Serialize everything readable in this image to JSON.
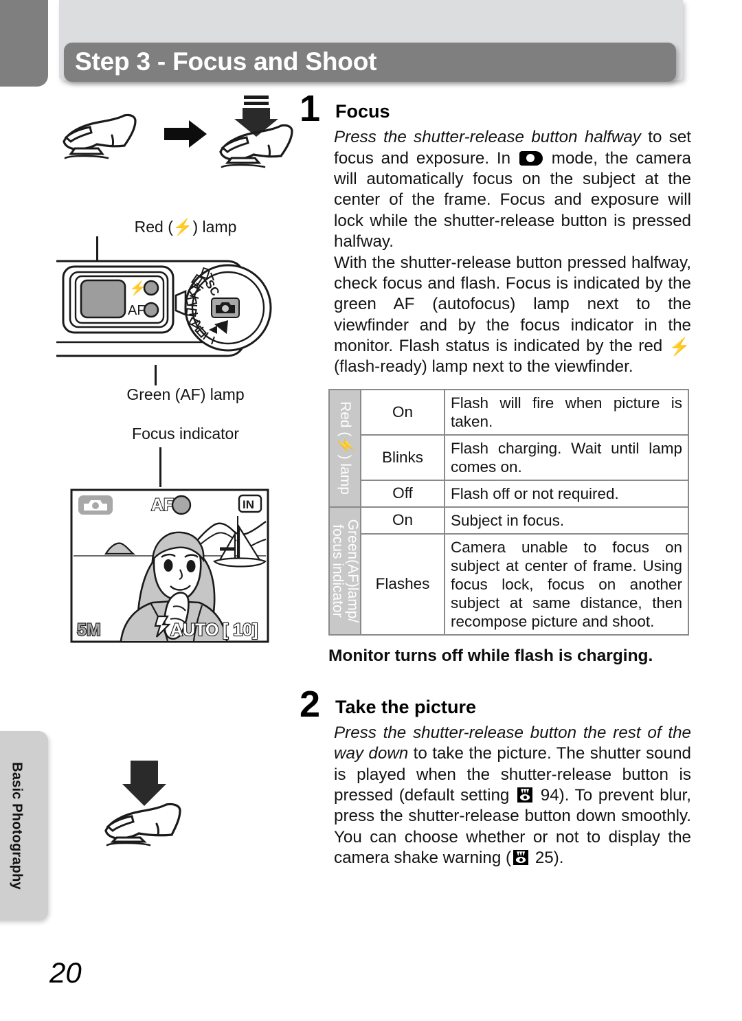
{
  "header": {
    "title": "Step 3 - Focus and Shoot",
    "tab_color": "#7f7f7f",
    "panel_color": "#dcdddf"
  },
  "side_tab": {
    "label": "Basic Photography"
  },
  "page_number": "20",
  "steps": [
    {
      "number": "1",
      "title": "Focus",
      "paragraphs": [
        {
          "segments": [
            {
              "text": "Press the shutter-release button halfway",
              "style": "italic"
            },
            {
              "text": " to set focus and exposure. In ",
              "style": "normal"
            },
            {
              "text": "",
              "style": "icon",
              "icon": "camera-mode-icon"
            },
            {
              "text": " mode, the camera will automatically focus on the subject at the center of the frame. Focus and exposure will lock while the shutter-release button is pressed halfway.",
              "style": "normal"
            }
          ]
        },
        {
          "segments": [
            {
              "text": "With the shutter-release button pressed halfway, check focus and flash. Focus is indicated by the green AF (autofocus) lamp next to the viewfinder and by the focus indicator in the monitor. Flash status is indicated by the red ",
              "style": "normal"
            },
            {
              "text": "",
              "style": "icon",
              "icon": "flash-bolt-icon"
            },
            {
              "text": " (flash-ready) lamp next to the viewfinder.",
              "style": "normal"
            }
          ]
        }
      ]
    },
    {
      "number": "2",
      "title": "Take the picture",
      "paragraphs": [
        {
          "segments": [
            {
              "text": "Press the shutter-release button the rest of the way down",
              "style": "italic"
            },
            {
              "text": " to take the picture. The shutter sound is played when the shutter-release button is pressed (default setting ",
              "style": "normal"
            },
            {
              "text": "",
              "style": "icon",
              "icon": "page-reference-icon"
            },
            {
              "text": " 94). To prevent blur, press the shutter-release button down smoothly. You can choose whether or not to display the camera shake warning (",
              "style": "normal"
            },
            {
              "text": "",
              "style": "icon",
              "icon": "page-reference-icon"
            },
            {
              "text": " 25).",
              "style": "normal"
            }
          ]
        }
      ]
    }
  ],
  "lamp_table": {
    "groups": [
      {
        "header_lines": [
          "Red (⚡) lamp"
        ],
        "header_plain": "Red (flash) lamp",
        "rows": [
          {
            "state": "On",
            "description": "Flash will fire when picture is taken."
          },
          {
            "state": "Blinks",
            "description": "Flash charging. Wait until lamp comes on."
          },
          {
            "state": "Off",
            "description": "Flash off or not required."
          }
        ]
      },
      {
        "header_lines": [
          "Green(AF)lamp/",
          "focus indicator"
        ],
        "header_plain": "Green(AF)lamp/focus indicator",
        "rows": [
          {
            "state": "On",
            "description": "Subject in focus."
          },
          {
            "state": "Flashes",
            "description": "Camera unable to focus on subject at center of frame. Using focus lock, focus on another subject at same distance, then recompose picture and shoot."
          }
        ]
      }
    ]
  },
  "table_note": "Monitor turns off while flash is charging.",
  "figures": {
    "press_halfway": {
      "caption_red_lamp": "Red (⚡) lamp",
      "caption_green_lamp": "Green (AF) lamp",
      "caption_focus_indicator": "Focus indicator"
    },
    "camera_back": {
      "flash_lamp_label": "⚡",
      "af_lamp_label": "AF",
      "dial_mode_label": "SC"
    },
    "monitor": {
      "focus_indicator": "AF",
      "memory_icon": "IN",
      "image_size": "5M",
      "flash_mode": "AUTO",
      "shots_remaining": "10",
      "shots_bracket_left": "[",
      "shots_bracket_right": "]"
    }
  }
}
